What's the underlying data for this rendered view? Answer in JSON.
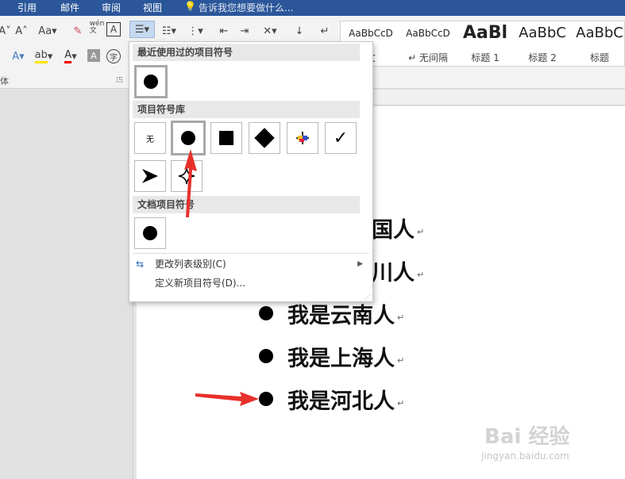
{
  "menubar": {
    "tabs": [
      "引用",
      "邮件",
      "审阅",
      "视图"
    ],
    "tell_me": "告诉我您想要做什么..."
  },
  "ribbon": {
    "font_group_label": "体",
    "wen_label": "wén\n文",
    "styles": [
      {
        "preview": "AaBbCcD",
        "name": "文"
      },
      {
        "preview": "AaBbCcD",
        "name": "↵ 无间隔"
      },
      {
        "preview": "AaBl",
        "name": "标题 1"
      },
      {
        "preview": "AaBbC",
        "name": "标题 2"
      },
      {
        "preview": "AaBbC",
        "name": "标题"
      }
    ]
  },
  "dropdown": {
    "recent_header": "最近使用过的项目符号",
    "library_header": "项目符号库",
    "none_label": "无",
    "document_header": "文档项目符号",
    "change_level": "更改列表级别(C)",
    "define_new": "定义新项目符号(D)..."
  },
  "document": {
    "lines": [
      "我是云南人",
      "我是上海人",
      "我是河北人"
    ],
    "partial_line1": "国人",
    "partial_line2": "川人",
    "para_mark": "↵"
  },
  "watermark": {
    "text": "Bai 经验",
    "url": "jingyan.baidu.com"
  }
}
